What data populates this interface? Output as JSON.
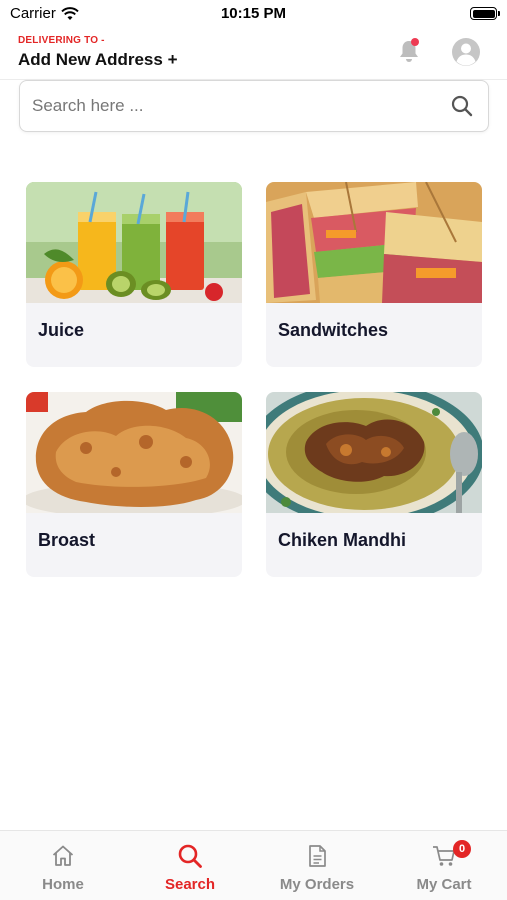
{
  "status_bar": {
    "carrier": "Carrier",
    "time": "10:15 PM"
  },
  "header": {
    "deliver_label": "DELIVERING TO -",
    "address": "Add New Address +"
  },
  "search": {
    "placeholder": "Search here ..."
  },
  "categories": [
    {
      "label": "Juice"
    },
    {
      "label": "Sandwitches"
    },
    {
      "label": "Broast"
    },
    {
      "label": "Chiken Mandhi"
    }
  ],
  "nav": {
    "items": [
      {
        "label": "Home",
        "icon": "home-icon",
        "active": false
      },
      {
        "label": "Search",
        "icon": "search-icon",
        "active": true
      },
      {
        "label": "My Orders",
        "icon": "document-icon",
        "active": false
      },
      {
        "label": "My Cart",
        "icon": "cart-icon",
        "active": false
      }
    ],
    "cart_count": "0"
  },
  "colors": {
    "accent": "#e32626",
    "card_bg": "#f4f4f7",
    "inactive": "#8a8a8a",
    "notification": "#ee3b53"
  }
}
